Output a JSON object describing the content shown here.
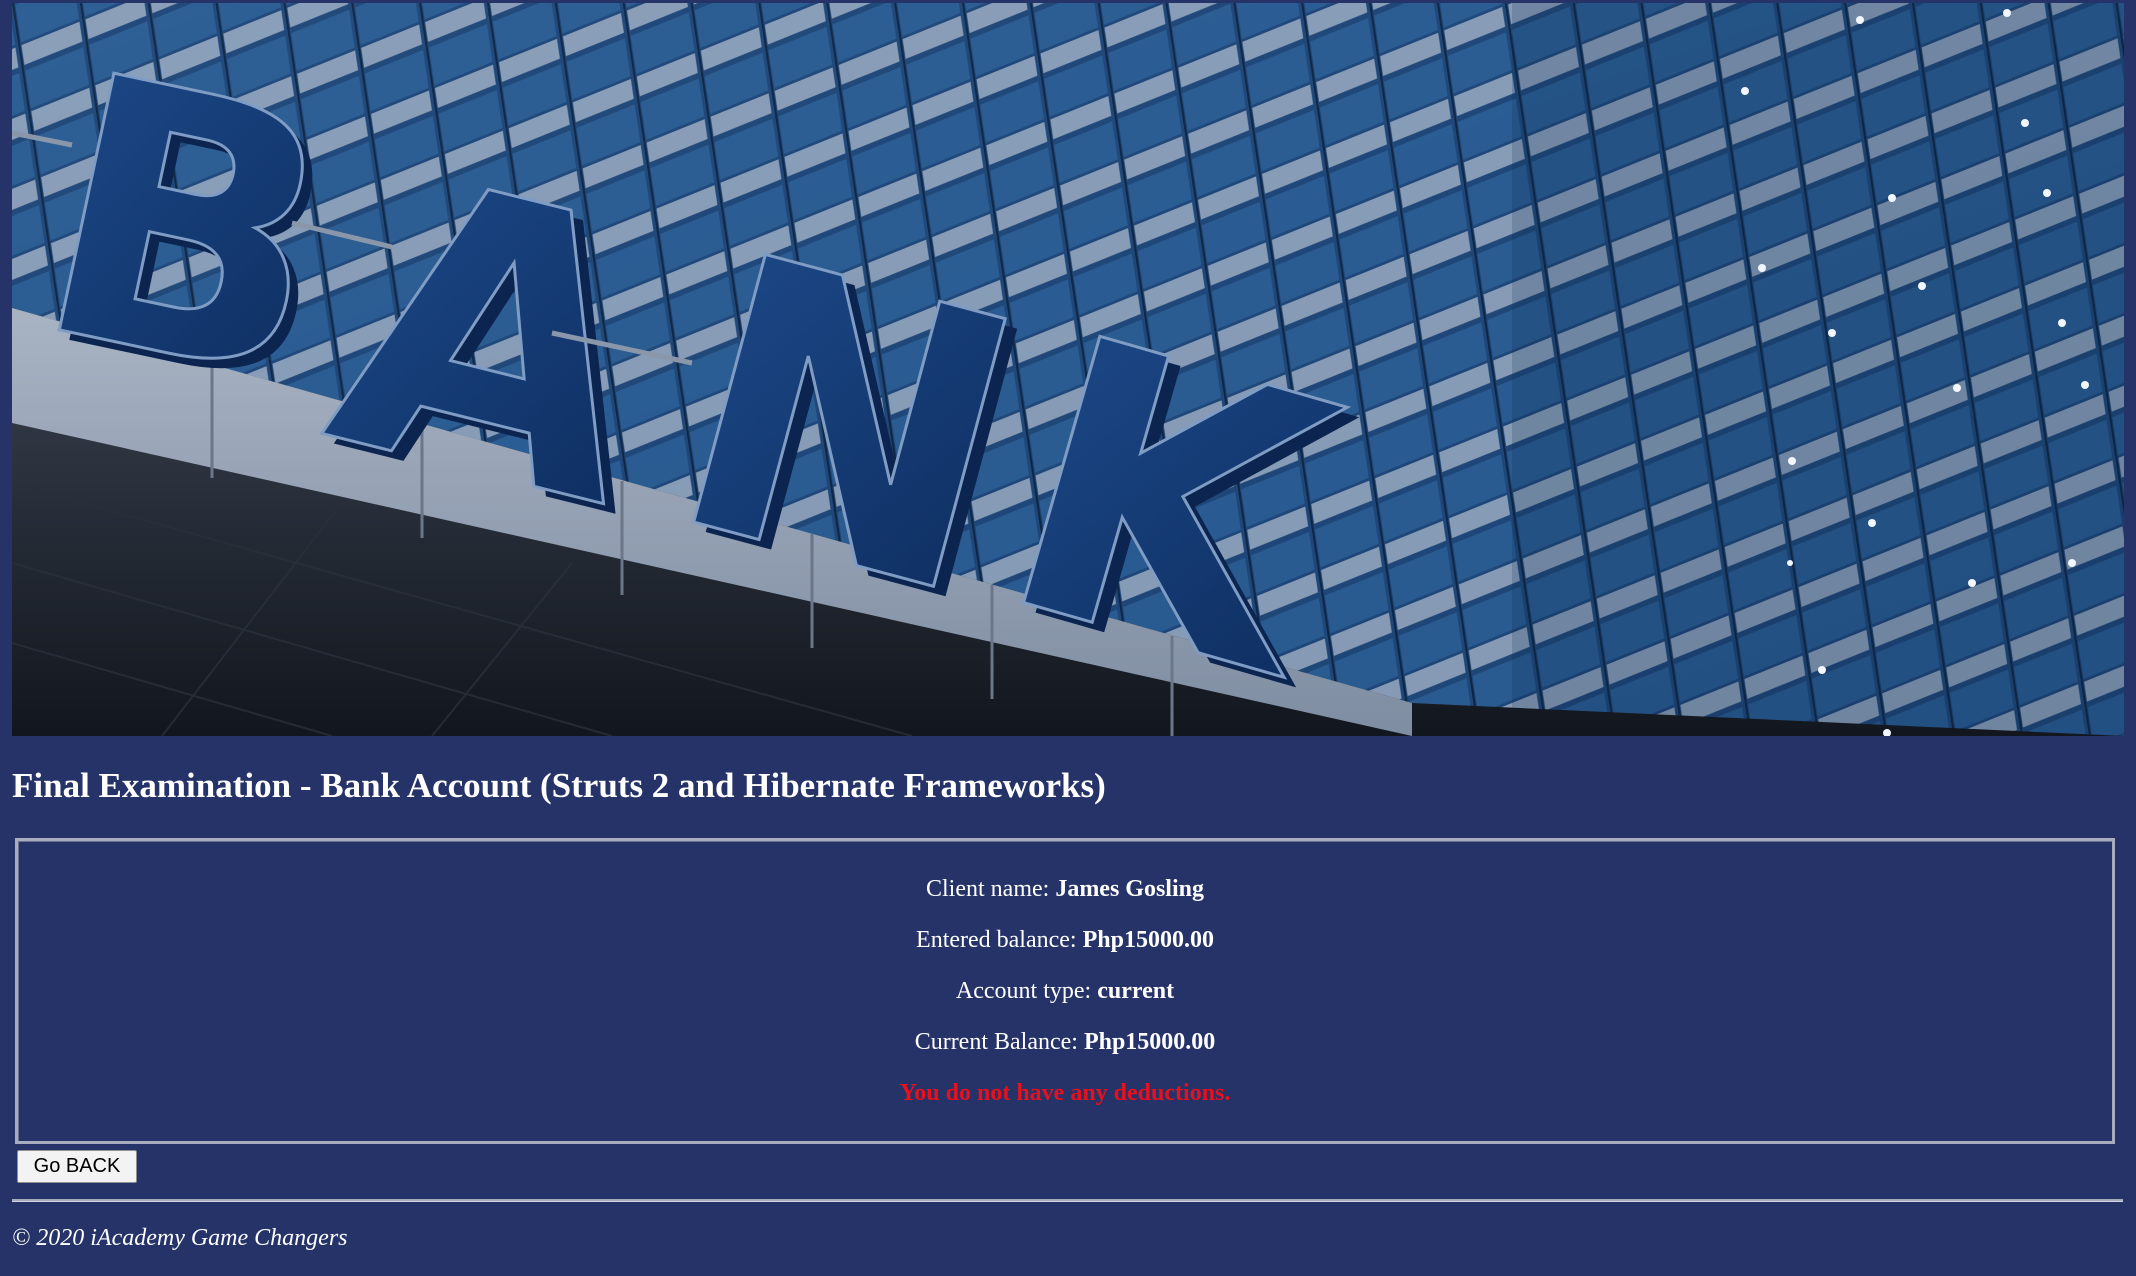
{
  "banner": {
    "sign_text": "BANK"
  },
  "header": {
    "title": "Final Examination - Bank Account (Struts 2 and Hibernate Frameworks)"
  },
  "result": {
    "client_name_label": "Client name: ",
    "client_name_value": "James Gosling",
    "entered_balance_label": "Entered balance: ",
    "entered_balance_value": "Php15000.00",
    "account_type_label": "Account type: ",
    "account_type_value": "current",
    "current_balance_label": "Current Balance: ",
    "current_balance_value": "Php15000.00",
    "deductions_message": "You do not have any deductions."
  },
  "actions": {
    "back_label": "Go BACK"
  },
  "footer": {
    "copyright": "© 2020 iAcademy Game Changers"
  },
  "colors": {
    "page_background": "#253369",
    "warning_text": "#e8101a",
    "text": "#ffffff"
  }
}
